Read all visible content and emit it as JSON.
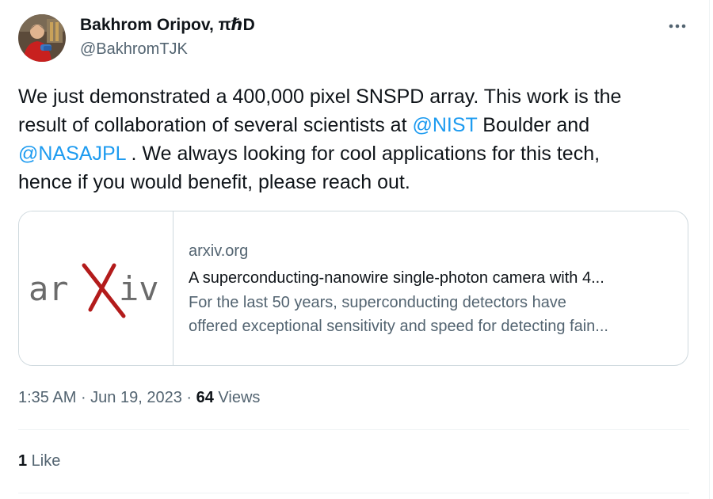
{
  "tweet": {
    "author": {
      "display_name": "Bakhrom Oripov, πℏD",
      "handle": "@BakhromTJK",
      "avatar_icon": "profile-photo"
    },
    "more_icon": "more-horizontal-icon",
    "text": {
      "line1": "We just demonstrated a 400,000 pixel SNSPD array. This work is the",
      "line2_before": "result of collaboration of several scientists at ",
      "mention1": "@NIST",
      "line2_after": " Boulder and",
      "mention2": "@NASAJPL",
      "line3_after": " . We always looking for cool applications for this tech,",
      "line4": "hence if you would benefit, please reach out."
    },
    "link_card": {
      "thumbnail_text_left": "ar",
      "thumbnail_text_x": "X",
      "thumbnail_text_right": "iv",
      "domain": "arxiv.org",
      "title": "A superconducting-nanowire single-photon camera with 4...",
      "description_line1": "For the last 50 years, superconducting detectors have",
      "description_line2": "offered exceptional sensitivity and speed for detecting fain..."
    },
    "meta": {
      "time": "1:35 AM",
      "sep1": " · ",
      "date": "Jun 19, 2023",
      "sep2": " · ",
      "views_count": "64",
      "views_label": " Views"
    },
    "stats": {
      "like_count": "1",
      "like_label": " Like"
    }
  },
  "colors": {
    "text": "#0f1419",
    "secondary": "#536471",
    "link": "#1d9bf0",
    "border": "#cfd9de",
    "divider": "#eff3f4",
    "arxiv_gray": "#6b6b6b",
    "arxiv_red": "#b31b1b"
  }
}
